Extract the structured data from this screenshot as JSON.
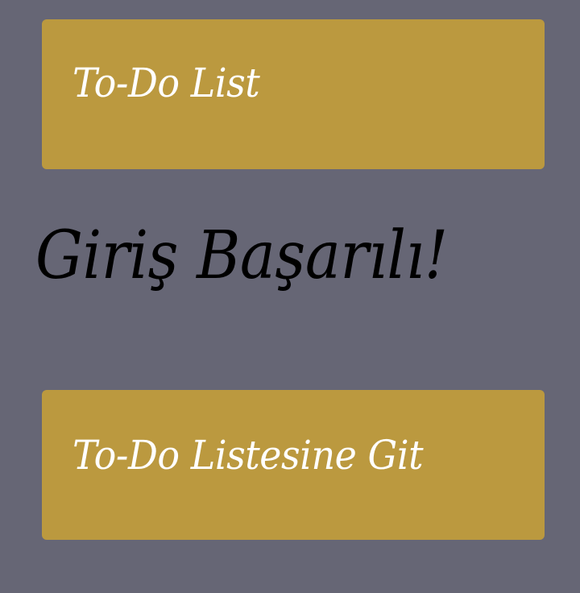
{
  "header": {
    "title": "To-Do List"
  },
  "main": {
    "message": "Giriş Başarılı!"
  },
  "nav": {
    "button_label": "To-Do Listesine Git"
  },
  "colors": {
    "background": "#666675",
    "panel": "#bb993f",
    "panel_text": "#ffffff",
    "message_text": "#000000"
  }
}
